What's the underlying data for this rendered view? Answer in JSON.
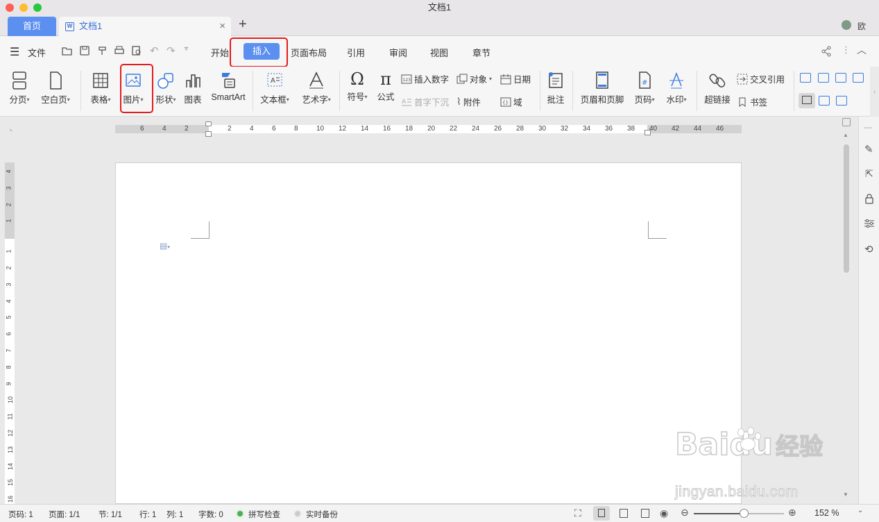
{
  "window": {
    "title": "文档1"
  },
  "tabs": {
    "home": "首页",
    "doc": "文档1",
    "add": "+",
    "user": "欧"
  },
  "menu": {
    "file": "文件",
    "items": [
      "开始",
      "插入",
      "页面布局",
      "引用",
      "审阅",
      "视图",
      "章节"
    ],
    "active": "插入"
  },
  "ribbon": {
    "page_break": "分页",
    "blank_page": "空白页",
    "table": "表格",
    "picture": "图片",
    "shape": "形状",
    "chart": "图表",
    "smartart": "SmartArt",
    "textbox": "文本框",
    "wordart": "艺术字",
    "symbol": "符号",
    "formula": "公式",
    "insert_number": "插入数字",
    "drop_cap": "首字下沉",
    "object": "对象",
    "attachment": "附件",
    "date": "日期",
    "field": "域",
    "comment": "批注",
    "header_footer": "页眉和页脚",
    "page_number": "页码",
    "watermark": "水印",
    "hyperlink": "超链接",
    "cross_ref": "交叉引用",
    "bookmark": "书签"
  },
  "ruler": {
    "h_ticks": [
      "6",
      "4",
      "2",
      "2",
      "4",
      "6",
      "8",
      "10",
      "12",
      "14",
      "16",
      "18",
      "20",
      "22",
      "24",
      "26",
      "28",
      "30",
      "32",
      "34",
      "36",
      "38",
      "40",
      "42",
      "44",
      "46"
    ],
    "v_ticks": [
      "4",
      "3",
      "2",
      "1",
      "1",
      "2",
      "3",
      "4",
      "5",
      "6",
      "7",
      "8",
      "9",
      "10",
      "11",
      "12",
      "13",
      "14",
      "15",
      "16"
    ]
  },
  "status": {
    "page_code": "页码: 1",
    "pages": "页面: 1/1",
    "section": "节: 1/1",
    "row": "行: 1",
    "col": "列: 1",
    "words": "字数: 0",
    "spell": "拼写检查",
    "backup": "实时备份",
    "zoom": "152 %"
  },
  "watermark": {
    "brand": "Bai",
    "brand2": "du",
    "cn": "经验",
    "url": "jingyan.baidu.com"
  },
  "colors": {
    "accent": "#5b8ff0",
    "highlight": "#e31b1b",
    "icon_blue": "#3b7be0"
  }
}
